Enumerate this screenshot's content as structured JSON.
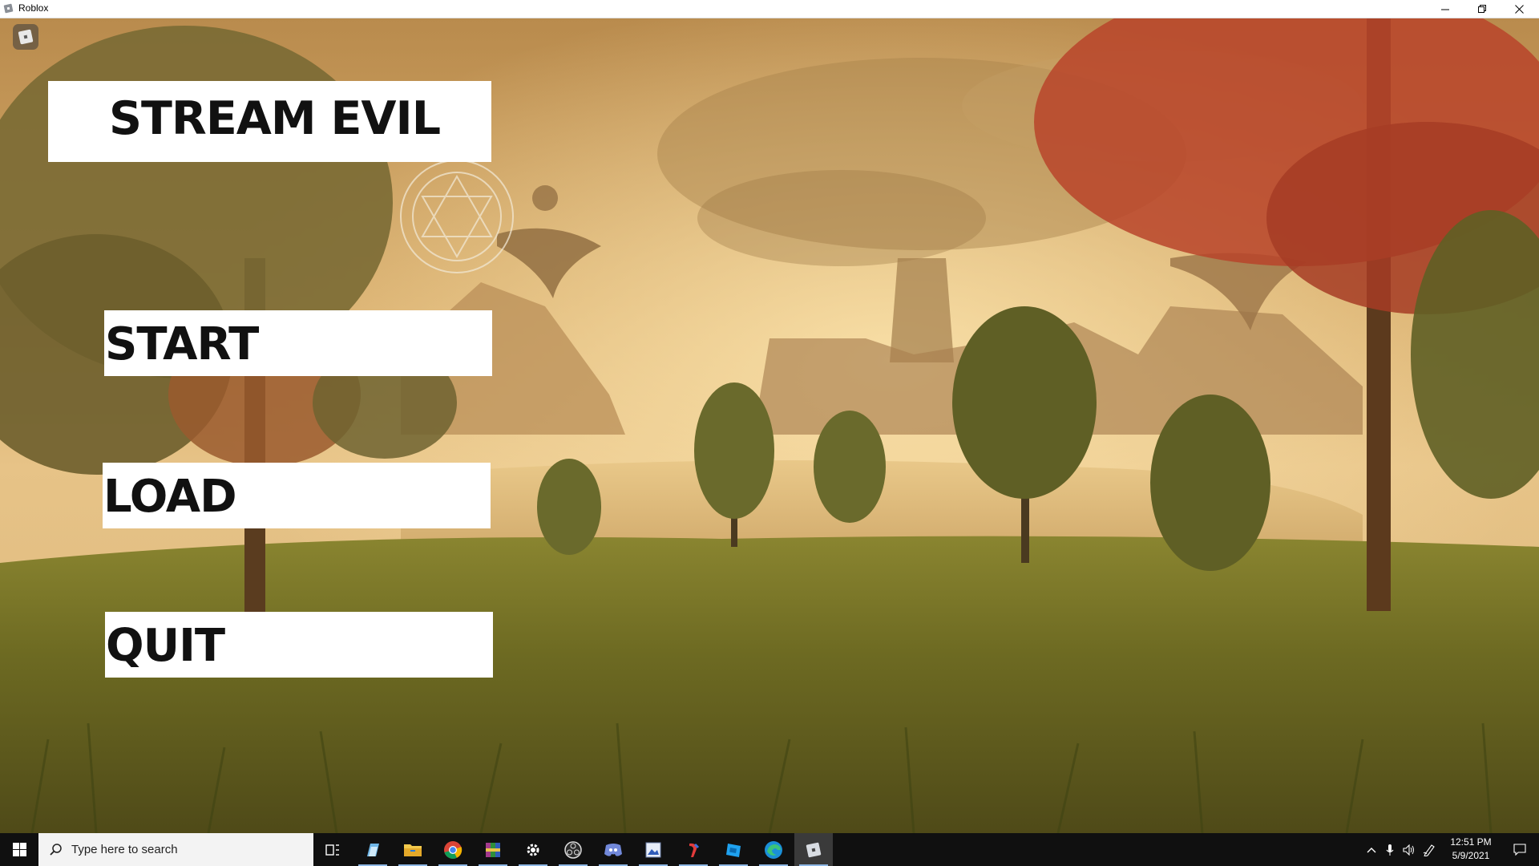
{
  "window": {
    "title": "Roblox",
    "app_icon": "roblox-icon",
    "controls": [
      "minimize-icon",
      "restore-icon",
      "close-icon"
    ]
  },
  "game": {
    "title": "STREAM EVIL",
    "menu_icon": "roblox-menu-icon",
    "buttons": {
      "start": "START",
      "load": "LOAD",
      "quit": "QUIT"
    }
  },
  "taskbar": {
    "start_icon": "windows-start-icon",
    "search_placeholder": "Type here to search",
    "apps": [
      "task-view-icon",
      "paint-icon",
      "file-explorer-icon",
      "chrome-icon",
      "winrar-icon",
      "settings-icon",
      "obs-icon",
      "discord-icon",
      "image-editor-icon",
      "paint-tool-icon",
      "roblox-studio-icon",
      "edge-icon",
      "roblox-icon"
    ],
    "tray": [
      "chevron-up-icon",
      "microphone-icon",
      "volume-icon",
      "pen-icon",
      "notification-icon"
    ],
    "clock": {
      "time": "12:51 PM",
      "date": "5/9/2021"
    }
  },
  "colors": {
    "sky": "#c9a15e",
    "grass": "#6b6a22",
    "panel": "#ffffff",
    "taskbar": "#101010"
  }
}
